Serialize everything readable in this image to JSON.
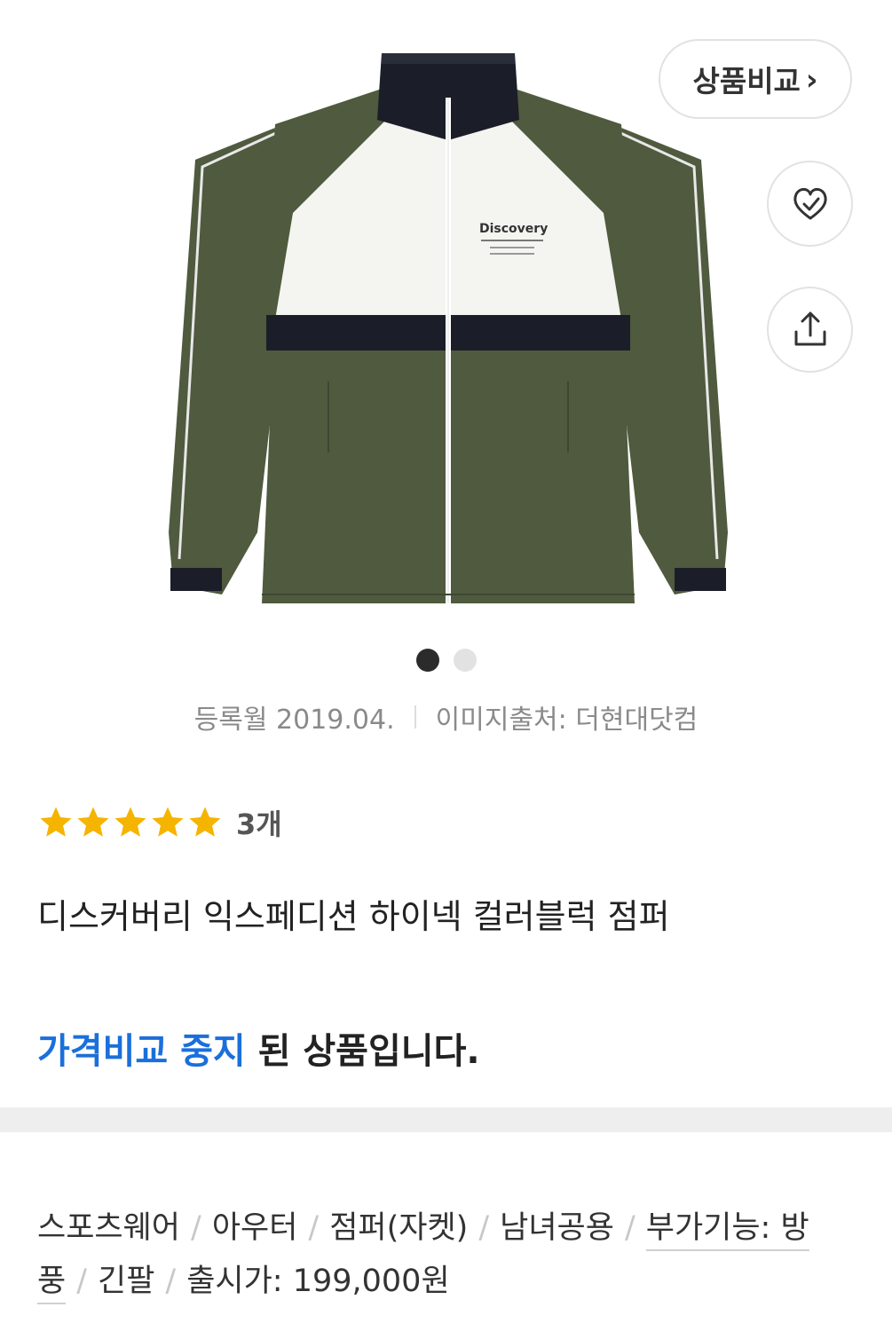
{
  "top_actions": {
    "compare_label": "상품비교",
    "compare_chevron": "›"
  },
  "gallery": {
    "active_index": 0,
    "dot_count": 2,
    "product_image_alt": "Discovery jacket",
    "logo_text": "Discovery"
  },
  "meta": {
    "registered": "등록월 2019.04.",
    "image_source": "이미지출처: 더현대닷컴"
  },
  "rating": {
    "stars": 5,
    "count_label": "3개"
  },
  "product": {
    "title": "디스커버리 익스페디션 하이넥 컬러블럭 점퍼",
    "status_accent": "가격비교 중지",
    "status_rest": " 된 상품입니다."
  },
  "tags": [
    "스포츠웨어",
    "아우터",
    "점퍼(자켓)",
    "남녀공용",
    "부가기능: 방풍",
    "긴팔",
    "출시가: 199,000원"
  ],
  "colors": {
    "accent_blue": "#1a6fdb",
    "star_yellow": "#f5b400",
    "jacket_olive": "#4f5a3e",
    "jacket_white": "#f4f4f0",
    "jacket_navy": "#1b1e28"
  }
}
